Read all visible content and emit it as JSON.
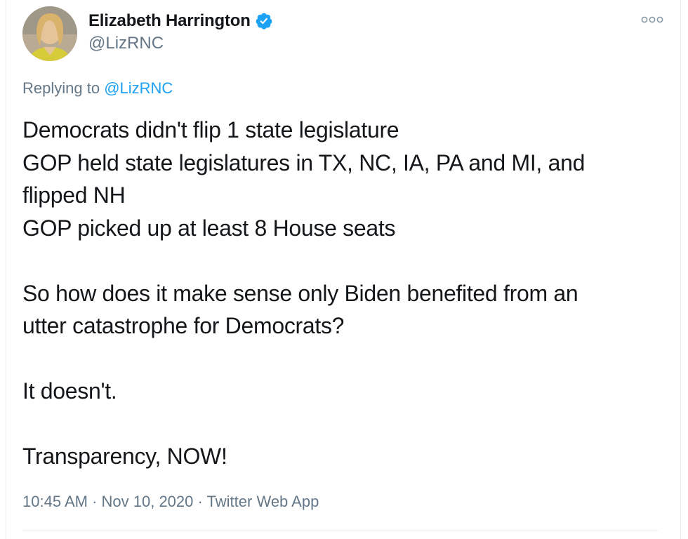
{
  "author": {
    "display_name": "Elizabeth Harrington",
    "handle": "@LizRNC",
    "verified": true,
    "avatar_icon": "profile-photo"
  },
  "reply": {
    "prefix": "Replying to ",
    "handle": "@LizRNC"
  },
  "tweet": {
    "lines": [
      "Democrats didn't flip 1 state legislature",
      "GOP held state legislatures in TX, NC, IA, PA and MI, and",
      "flipped NH",
      "GOP picked up at least 8 House seats",
      "",
      "So how does it make sense only Biden benefited from an",
      "utter catastrophe for Democrats?",
      "",
      "It doesn't.",
      "",
      "Transparency, NOW!"
    ]
  },
  "meta": {
    "time": "10:45 AM",
    "separator": " · ",
    "date": "Nov 10, 2020",
    "source": "Twitter Web App"
  },
  "colors": {
    "text": "#14171a",
    "secondary": "#657786",
    "accent": "#1da1f2",
    "border": "#e6ecf0"
  },
  "icons": {
    "verified": "verified-badge-icon",
    "more": "more-options-icon"
  }
}
